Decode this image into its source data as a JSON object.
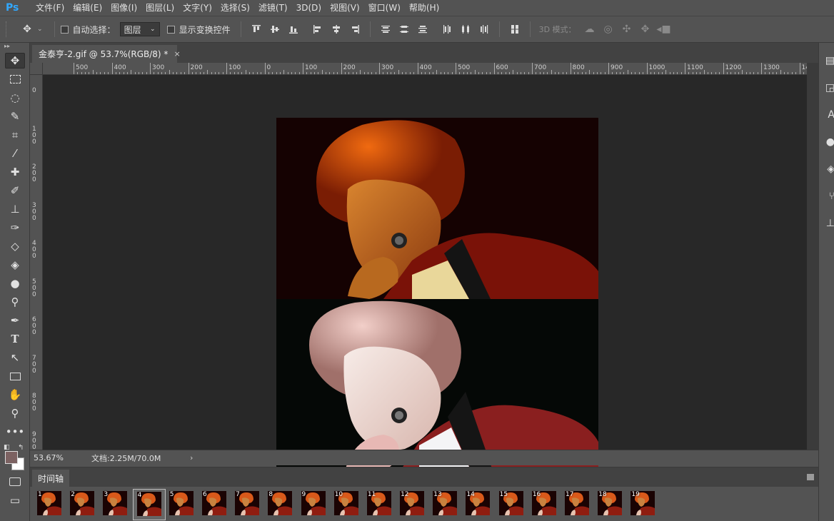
{
  "app": {
    "logo": "Ps"
  },
  "menu": {
    "items": [
      "文件(F)",
      "编辑(E)",
      "图像(I)",
      "图层(L)",
      "文字(Y)",
      "选择(S)",
      "滤镜(T)",
      "3D(D)",
      "视图(V)",
      "窗口(W)",
      "帮助(H)"
    ]
  },
  "options": {
    "auto_select_label": "自动选择：",
    "auto_select_value": "图层",
    "show_transform_label": "显示变换控件",
    "mode_label": "3D 模式："
  },
  "document": {
    "tab_title": "金泰亨-2.gif @ 53.7%(RGB/8) *",
    "tab_close": "×"
  },
  "ruler": {
    "h_labels": [
      "500",
      "400",
      "300",
      "200",
      "100",
      "0",
      "100",
      "200",
      "300",
      "400",
      "500",
      "600",
      "700",
      "800",
      "900",
      "1000",
      "1100",
      "1200",
      "1300",
      "14"
    ],
    "v_labels": [
      "0",
      "100",
      "200",
      "300",
      "400",
      "500",
      "600",
      "700",
      "800",
      "900"
    ]
  },
  "status": {
    "zoom": "53.67%",
    "doc_info": "文档:2.25M/70.0M",
    "arrow": "›"
  },
  "timeline": {
    "tab_label": "时间轴",
    "selected_frame": 4,
    "frames": [
      "1",
      "2",
      "3",
      "4",
      "5",
      "6",
      "7",
      "8",
      "9",
      "10",
      "11",
      "12",
      "13",
      "14",
      "15",
      "16",
      "17",
      "18",
      "19"
    ]
  },
  "colors": {
    "foreground": "#7c6262",
    "background": "#ffffff",
    "accent": "#31a8ff"
  }
}
